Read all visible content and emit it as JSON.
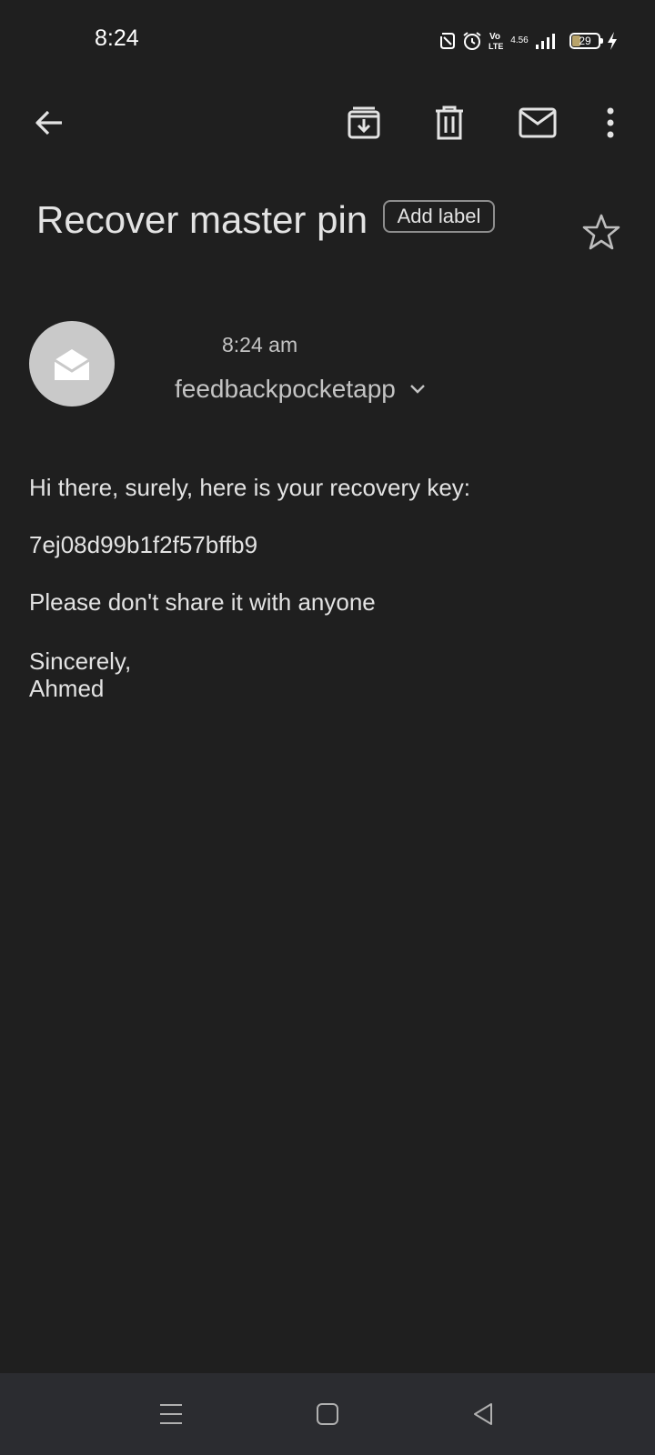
{
  "status_bar": {
    "time": "8:24",
    "network_speed_value": "4.56",
    "battery_level": "29",
    "icons": [
      "nfc-icon",
      "alarm-icon",
      "volte-icon",
      "signal-icon",
      "battery-icon",
      "charging-icon"
    ]
  },
  "app_bar": {
    "icons": [
      "back-arrow-icon",
      "archive-icon",
      "delete-icon",
      "mark-unread-icon",
      "more-options-icon"
    ]
  },
  "email": {
    "subject": "Recover master pin",
    "add_label": "Add label",
    "sent_time": "8:24 am",
    "sender": "feedbackpocketapp",
    "body": {
      "greeting": "Hi there, surely, here is your recovery key:",
      "recovery_key": "7ej08d99b1f2f57bffb9",
      "warning": "Please don't share it with anyone",
      "signoff": "Sincerely,",
      "signature": "Ahmed"
    }
  },
  "nav_bar": {
    "icons": [
      "recents-icon",
      "home-icon",
      "back-icon"
    ]
  },
  "colors": {
    "background": "#1f1f1f",
    "text": "#e3e3e3",
    "secondary_text": "#c4c4c4",
    "nav_background": "#2b2c30",
    "avatar": "#c9c9c9"
  }
}
